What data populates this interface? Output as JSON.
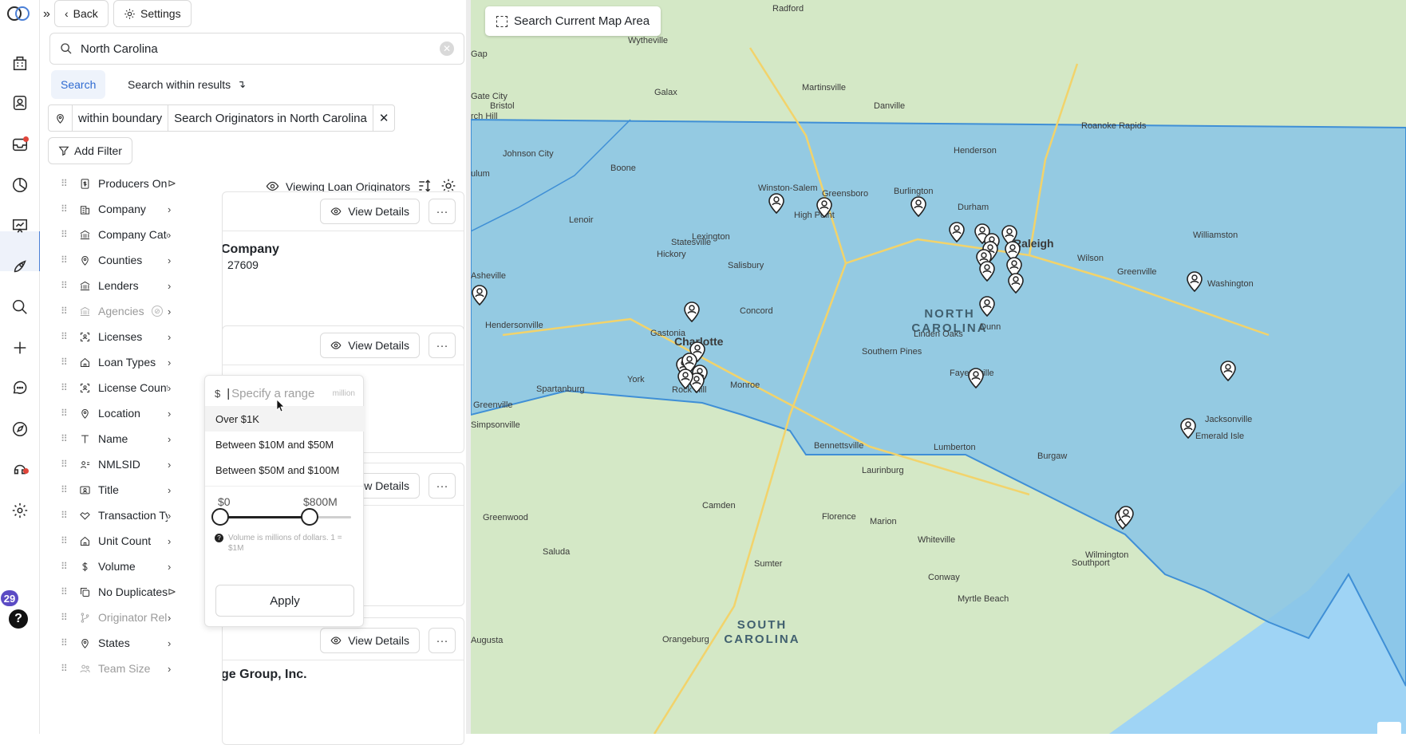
{
  "nav": {
    "badge_count": "29",
    "help_label": "?"
  },
  "header": {
    "back_label": "Back",
    "settings_label": "Settings"
  },
  "search": {
    "value": "North Carolina",
    "tab_search": "Search",
    "tab_within": "Search within results"
  },
  "boundary_chip": {
    "mode": "within boundary",
    "label": "Search Originators in North Carolina"
  },
  "add_filter_label": "Add Filter",
  "viewing_label": "Viewing Loan Originators",
  "filters": [
    {
      "label": "Producers Only",
      "icon": "dollar-doc-icon",
      "end": "tag"
    },
    {
      "label": "Company",
      "icon": "building-icon",
      "end": "chevron"
    },
    {
      "label": "Company Cate...",
      "icon": "bank-icon",
      "end": "chevron"
    },
    {
      "label": "Counties",
      "icon": "pin-icon",
      "end": "chevron"
    },
    {
      "label": "Lenders",
      "icon": "bank-icon",
      "end": "chevron"
    },
    {
      "label": "Agencies",
      "icon": "bank-icon",
      "end": "chevron",
      "dim": true
    },
    {
      "label": "Licenses",
      "icon": "license-icon",
      "end": "chevron"
    },
    {
      "label": "Loan Types",
      "icon": "house-icon",
      "end": "chevron"
    },
    {
      "label": "License Count",
      "icon": "license-icon",
      "end": "chevron"
    },
    {
      "label": "Location",
      "icon": "pin-icon",
      "end": "chevron"
    },
    {
      "label": "Name",
      "icon": "text-icon",
      "end": "chevron"
    },
    {
      "label": "NMLSID",
      "icon": "person-id-icon",
      "end": "chevron"
    },
    {
      "label": "Title",
      "icon": "id-card-icon",
      "end": "chevron"
    },
    {
      "label": "Transaction Ty...",
      "icon": "handshake-icon",
      "end": "chevron"
    },
    {
      "label": "Unit Count",
      "icon": "house-icon",
      "end": "chevron"
    },
    {
      "label": "Volume",
      "icon": "dollar-icon",
      "end": "chevron"
    },
    {
      "label": "No Duplicates",
      "icon": "copy-icon",
      "end": "tag"
    },
    {
      "label": "Originator Rela...",
      "icon": "branch-icon",
      "end": "chevron",
      "dim": true
    },
    {
      "label": "States",
      "icon": "pin-icon",
      "end": "chevron"
    },
    {
      "label": "Team Size",
      "icon": "team-icon",
      "end": "chevron",
      "dim": true
    }
  ],
  "cards": [
    {
      "view_label": "View Details",
      "name": "Company",
      "zip": "27609"
    },
    {
      "view_label": "View Details"
    },
    {
      "view_label": "View Details"
    },
    {
      "view_label": "View Details",
      "name": "ge Group, Inc."
    }
  ],
  "volume_dropdown": {
    "currency": "$",
    "placeholder": "Specify a range",
    "unit": "million",
    "options": [
      "Over $1K",
      "Between $10M and $50M",
      "Between $50M and $100M"
    ],
    "min_label": "$0",
    "max_label": "$800M",
    "range_fraction": [
      0,
      0.68
    ],
    "note": "Volume is millions of dollars. 1 = $1M",
    "apply_label": "Apply"
  },
  "map": {
    "search_area_label": "Search Current Map Area",
    "state_labels": [
      "NORTH CAROLINA",
      "SOUTH CAROLINA"
    ],
    "place_labels": [
      "Radford",
      "Wytheville",
      "Galax",
      "Martinsville",
      "Danville",
      "Bristol",
      "Johnson City",
      "Boone",
      "Winston-Salem",
      "Greensboro",
      "Burlington",
      "Durham",
      "Raleigh",
      "Henderson",
      "Roanoke Rapids",
      "High Point",
      "Lexington",
      "Statesville",
      "Hickory",
      "Lenoir",
      "Salisbury",
      "Concord",
      "Asheville",
      "Hendersonville",
      "Gastonia",
      "Charlotte",
      "Monroe",
      "Rock Hill",
      "York",
      "Spartanburg",
      "Greenville",
      "Simpsonville",
      "Greenwood",
      "Saluda",
      "Camden",
      "Florence",
      "Marion",
      "Sumter",
      "Laurinburg",
      "Lumberton",
      "Fayetteville",
      "Dunn",
      "Southern Pines",
      "Linden Oaks",
      "Wilson",
      "Greenville",
      "Washington",
      "Williamston",
      "Jacksonville",
      "Emerald Isle",
      "Wilmington",
      "Southport",
      "Myrtle Beach",
      "Conway",
      "Bennettsville",
      "Orangeburg",
      "Augusta",
      "Burgaw",
      "Whiteville",
      "Gate City",
      "Gap",
      "ulum",
      "rch Hill"
    ],
    "colors": {
      "land": "#cfe7c1",
      "boundary_fill": "#7fc0e6",
      "boundary_stroke": "#3f8fd6",
      "water": "#9fd4f5",
      "accent": "#2f6bd1"
    }
  }
}
